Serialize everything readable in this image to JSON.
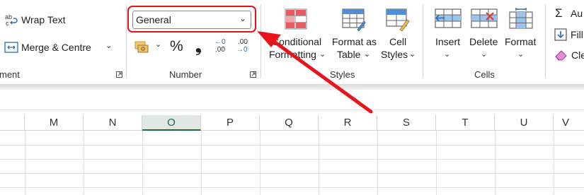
{
  "alignment": {
    "wrap_text_label": "Wrap Text",
    "merge_label": "Merge & Centre",
    "merge_chevron": "⌄",
    "group_label": "ment"
  },
  "number": {
    "format_value": "General",
    "format_chevron": "⌄",
    "accounting_chevron": "⌄",
    "percent_symbol": "%",
    "comma_symbol": "❟",
    "inc_decimal_top": "←0",
    "inc_decimal_bottom": ".00",
    "dec_decimal_top": ".00",
    "dec_decimal_bottom": "→0",
    "group_label": "Number"
  },
  "styles": {
    "conditional_line1": "Conditional",
    "conditional_line2": "Formatting",
    "format_table_line1": "Format as",
    "format_table_line2": "Table",
    "cell_styles_line1": "Cell",
    "cell_styles_line2": "Styles",
    "chevron": "⌄",
    "group_label": "Styles"
  },
  "cells": {
    "insert_label": "Insert",
    "delete_label": "Delete",
    "format_label": "Format",
    "chevron": "⌄",
    "group_label": "Cells"
  },
  "editing": {
    "autosum_label": "Au",
    "fill_label": "Fill",
    "clear_label": "Cle"
  },
  "columns": [
    "M",
    "N",
    "O",
    "P",
    "Q",
    "R",
    "S",
    "T",
    "U",
    "V"
  ],
  "selected_column": "O",
  "colors": {
    "highlight_red": "#e3141d",
    "arrow_red": "#e8141c",
    "selected_column_green": "#1d6b3f",
    "selected_column_bg": "#e1e7e3"
  }
}
